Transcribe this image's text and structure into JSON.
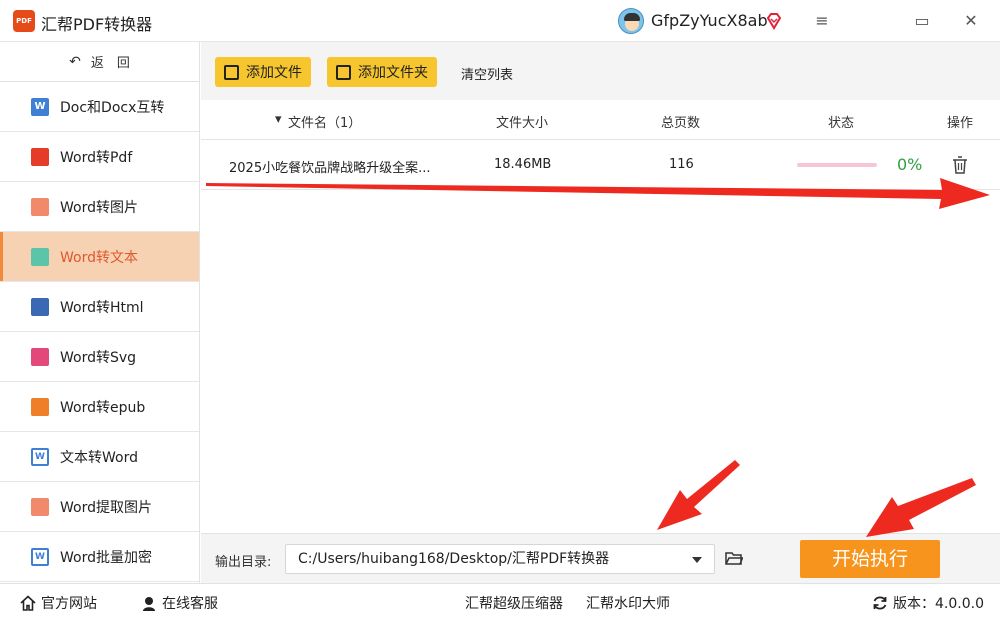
{
  "app": {
    "title": "汇帮PDF转换器",
    "logo_text": "PDF"
  },
  "user": {
    "name": "GfpZyYucX8ab"
  },
  "window_controls": {
    "menu": "≡",
    "maximize": "▭",
    "close": "✕"
  },
  "sidebar": {
    "back_label": "返　回",
    "items": [
      {
        "label": "Doc和Docx互转",
        "icon": "word-icon",
        "active": false
      },
      {
        "label": "Word转Pdf",
        "icon": "pdf-icon",
        "active": false
      },
      {
        "label": "Word转图片",
        "icon": "image-icon",
        "active": false
      },
      {
        "label": "Word转文本",
        "icon": "text-icon",
        "active": true
      },
      {
        "label": "Word转Html",
        "icon": "html-icon",
        "active": false
      },
      {
        "label": "Word转Svg",
        "icon": "svg-icon",
        "active": false
      },
      {
        "label": "Word转epub",
        "icon": "epub-icon",
        "active": false
      },
      {
        "label": "文本转Word",
        "icon": "word-out-icon",
        "active": false
      },
      {
        "label": "Word提取图片",
        "icon": "image-extract-icon",
        "active": false
      },
      {
        "label": "Word批量加密",
        "icon": "word-lock-icon",
        "active": false
      }
    ]
  },
  "toolbar": {
    "add_file": "添加文件",
    "add_folder": "添加文件夹",
    "clear_list": "清空列表"
  },
  "table": {
    "columns": {
      "name": "文件名（1）",
      "size": "文件大小",
      "pages": "总页数",
      "status": "状态",
      "action": "操作"
    },
    "rows": [
      {
        "name": "2025小吃餐饮品牌战略升级全案...",
        "size": "18.46MB",
        "pages": "116",
        "progress": 0,
        "progress_text": "0%"
      }
    ]
  },
  "output": {
    "label": "输出目录:",
    "path": "C:/Users/huibang168/Desktop/汇帮PDF转换器",
    "start_button": "开始执行"
  },
  "footer": {
    "website": "官方网站",
    "service": "在线客服",
    "compressor": "汇帮超级压缩器",
    "watermark": "汇帮水印大师",
    "version": "版本：4.0.0.0"
  },
  "colors": {
    "accent": "#f7941d",
    "button_yellow": "#f7c52d",
    "active_bg": "#f6d2b3",
    "progress_text": "#2ea043",
    "annotation": "#ee2a20"
  }
}
